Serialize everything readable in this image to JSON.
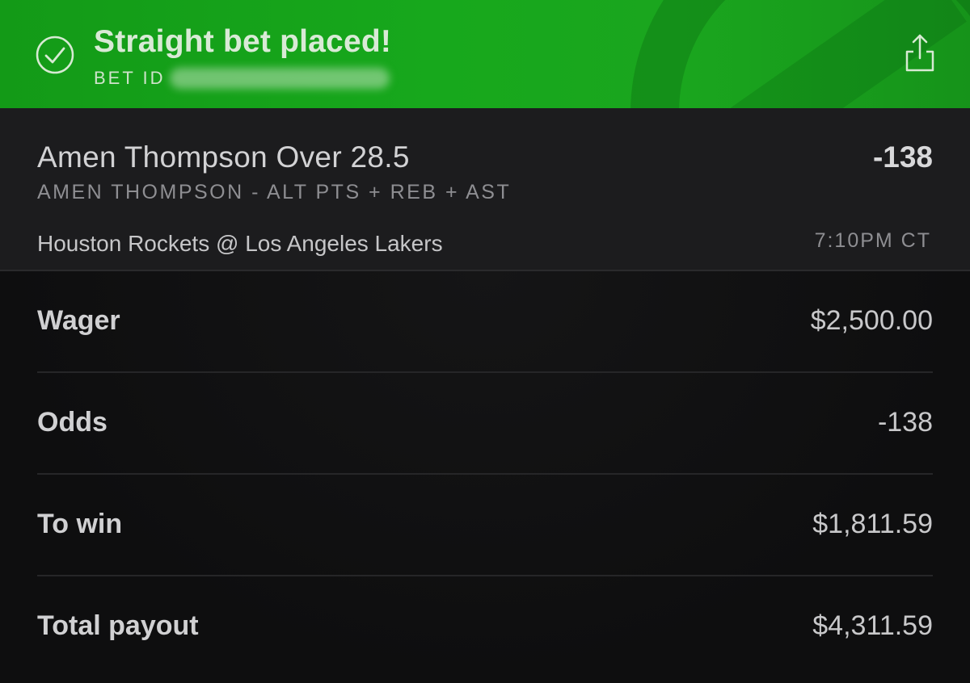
{
  "banner": {
    "title": "Straight bet placed!",
    "bet_id_label": "BET ID",
    "icons": {
      "status": "check-circle-icon",
      "share": "share-icon"
    },
    "color": "#17a81c"
  },
  "selection": {
    "title": "Amen Thompson Over 28.5",
    "odds": "-138",
    "market": "AMEN THOMPSON - ALT PTS + REB + AST",
    "game": "Houston Rockets @ Los Angeles Lakers",
    "time": "7:10PM CT"
  },
  "details": [
    {
      "label": "Wager",
      "value": "$2,500.00"
    },
    {
      "label": "Odds",
      "value": "-138"
    },
    {
      "label": "To win",
      "value": "$1,811.59"
    },
    {
      "label": "Total payout",
      "value": "$4,311.59"
    }
  ]
}
